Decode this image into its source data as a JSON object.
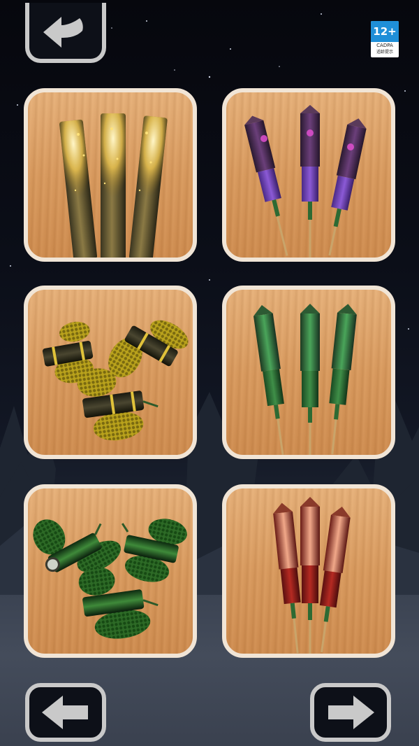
{
  "age_rating": {
    "number": "12+",
    "org": "CADPA",
    "caption": "适龄提示"
  },
  "navigation": {
    "back_icon": "back-arrow-icon",
    "prev_icon": "left-arrow-icon",
    "next_icon": "right-arrow-icon"
  },
  "items": [
    {
      "icon": "golden-sparkler-candles-icon",
      "color": "#c9a13b"
    },
    {
      "icon": "purple-rockets-icon",
      "color": "#7b3fa8"
    },
    {
      "icon": "yellow-butterfly-crackers-icon",
      "color": "#b9a21c"
    },
    {
      "icon": "green-rockets-icon",
      "color": "#2f8a3c"
    },
    {
      "icon": "green-butterfly-crackers-icon",
      "color": "#2d6a26"
    },
    {
      "icon": "red-rockets-icon",
      "color": "#b52a22"
    }
  ]
}
